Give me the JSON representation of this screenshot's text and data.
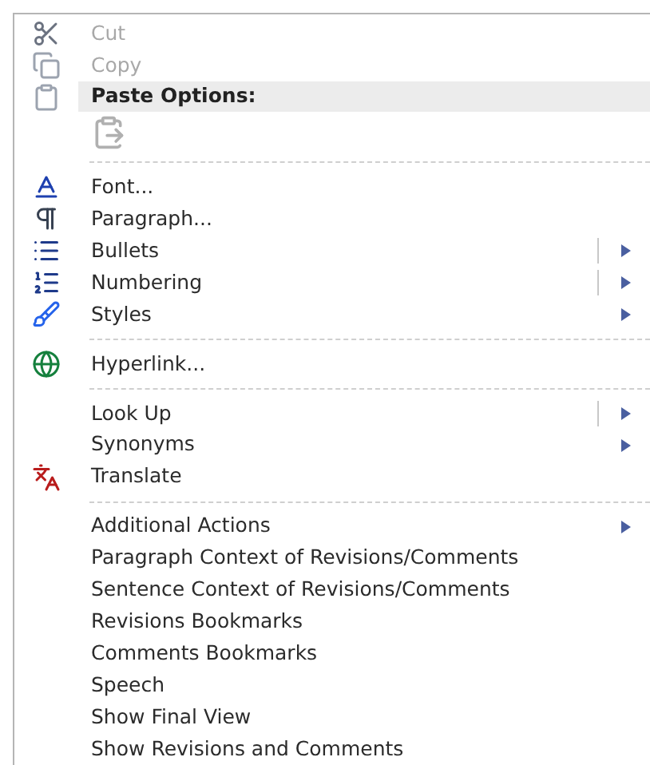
{
  "menu": {
    "items": [
      {
        "kind": "item",
        "label": "Cut",
        "disabled": true,
        "submenu": false,
        "split": false
      },
      {
        "kind": "item",
        "label": "Copy",
        "disabled": true,
        "submenu": false,
        "split": false
      },
      {
        "kind": "header",
        "label": "Paste Options:"
      },
      {
        "kind": "paste"
      },
      {
        "kind": "separator"
      },
      {
        "kind": "item",
        "label": "Font...",
        "disabled": false,
        "submenu": false,
        "split": false
      },
      {
        "kind": "item",
        "label": "Paragraph...",
        "disabled": false,
        "submenu": false,
        "split": false
      },
      {
        "kind": "item",
        "label": "Bullets",
        "disabled": false,
        "submenu": true,
        "split": true
      },
      {
        "kind": "item",
        "label": "Numbering",
        "disabled": false,
        "submenu": true,
        "split": true
      },
      {
        "kind": "item",
        "label": "Styles",
        "disabled": false,
        "submenu": true,
        "split": false
      },
      {
        "kind": "separator"
      },
      {
        "kind": "item",
        "label": "Hyperlink...",
        "disabled": false,
        "submenu": false,
        "split": false
      },
      {
        "kind": "separator"
      },
      {
        "kind": "item",
        "label": "Look Up",
        "disabled": false,
        "submenu": true,
        "split": true
      },
      {
        "kind": "item",
        "label": "Synonyms",
        "disabled": false,
        "submenu": true,
        "split": false
      },
      {
        "kind": "item",
        "label": "Translate",
        "disabled": false,
        "submenu": false,
        "split": false
      },
      {
        "kind": "separator"
      },
      {
        "kind": "item",
        "label": "Additional Actions",
        "disabled": false,
        "submenu": true,
        "split": false
      },
      {
        "kind": "item",
        "label": "Paragraph Context of Revisions/Comments",
        "disabled": false,
        "submenu": false,
        "split": false
      },
      {
        "kind": "item",
        "label": "Sentence Context of Revisions/Comments",
        "disabled": false,
        "submenu": false,
        "split": false
      },
      {
        "kind": "item",
        "label": "Revisions Bookmarks",
        "disabled": false,
        "submenu": false,
        "split": false
      },
      {
        "kind": "item",
        "label": "Comments Bookmarks",
        "disabled": false,
        "submenu": false,
        "split": false
      },
      {
        "kind": "item",
        "label": "Speech",
        "disabled": false,
        "submenu": false,
        "split": false
      },
      {
        "kind": "item",
        "label": "Show Final View",
        "disabled": false,
        "submenu": false,
        "split": false
      },
      {
        "kind": "item",
        "label": "Show Revisions and Comments",
        "disabled": false,
        "submenu": false,
        "split": false
      }
    ]
  }
}
